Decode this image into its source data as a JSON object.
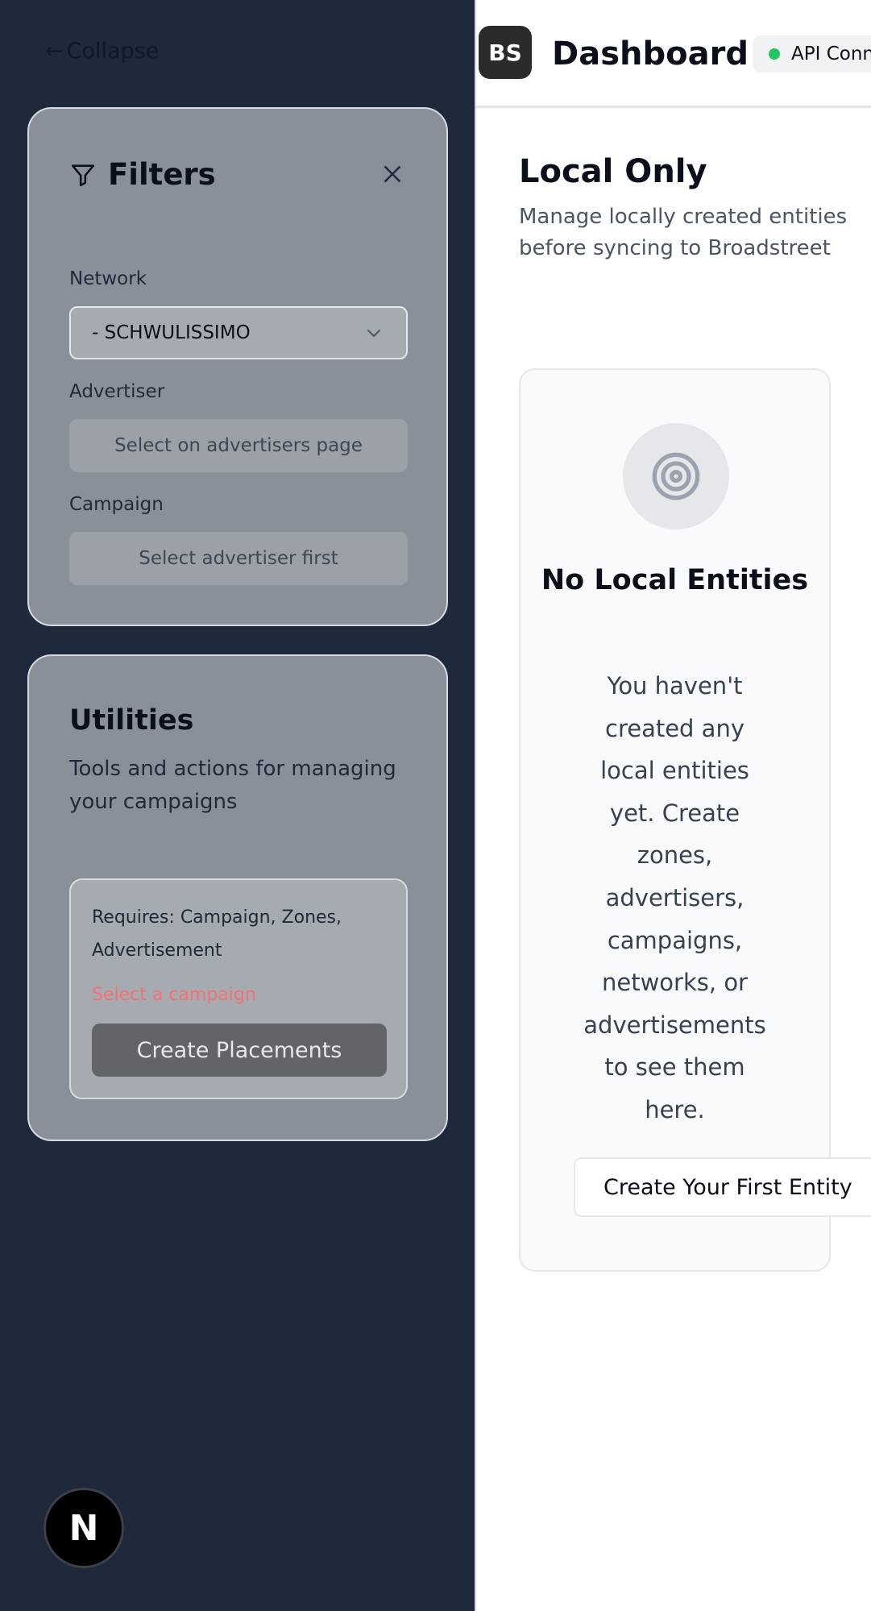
{
  "sidebar": {
    "collapse_label": "Collapse",
    "filters": {
      "title": "Filters",
      "network_label": "Network",
      "network_value": "- SCHWULISSIMO",
      "advertiser_label": "Advertiser",
      "advertiser_placeholder": "Select on advertisers page",
      "campaign_label": "Campaign",
      "campaign_placeholder": "Select advertiser first"
    },
    "utilities": {
      "title": "Utilities",
      "description": "Tools and actions for managing your campaigns",
      "requires": "Requires: Campaign, Zones, Advertisement",
      "warning": "Select a campaign",
      "button_label": "Create Placements"
    },
    "badge_letter": "N"
  },
  "header": {
    "avatar_initials": "BS",
    "title": "Dashboard",
    "api_status": "API Connected"
  },
  "main": {
    "title": "Local Only",
    "description": "Manage locally created entities before syncing to Broadstreet",
    "empty": {
      "title": "No Local Entities",
      "text": "You haven't created any local entities yet. Create zones, advertisers, campaigns, networks, or advertisements to see them here.",
      "button_label": "Create Your First Entity"
    }
  },
  "colors": {
    "sidebar_bg": "#1e293b",
    "panel_bg": "#8a9099",
    "status_green": "#22c55e",
    "warning_red": "#f87171"
  }
}
